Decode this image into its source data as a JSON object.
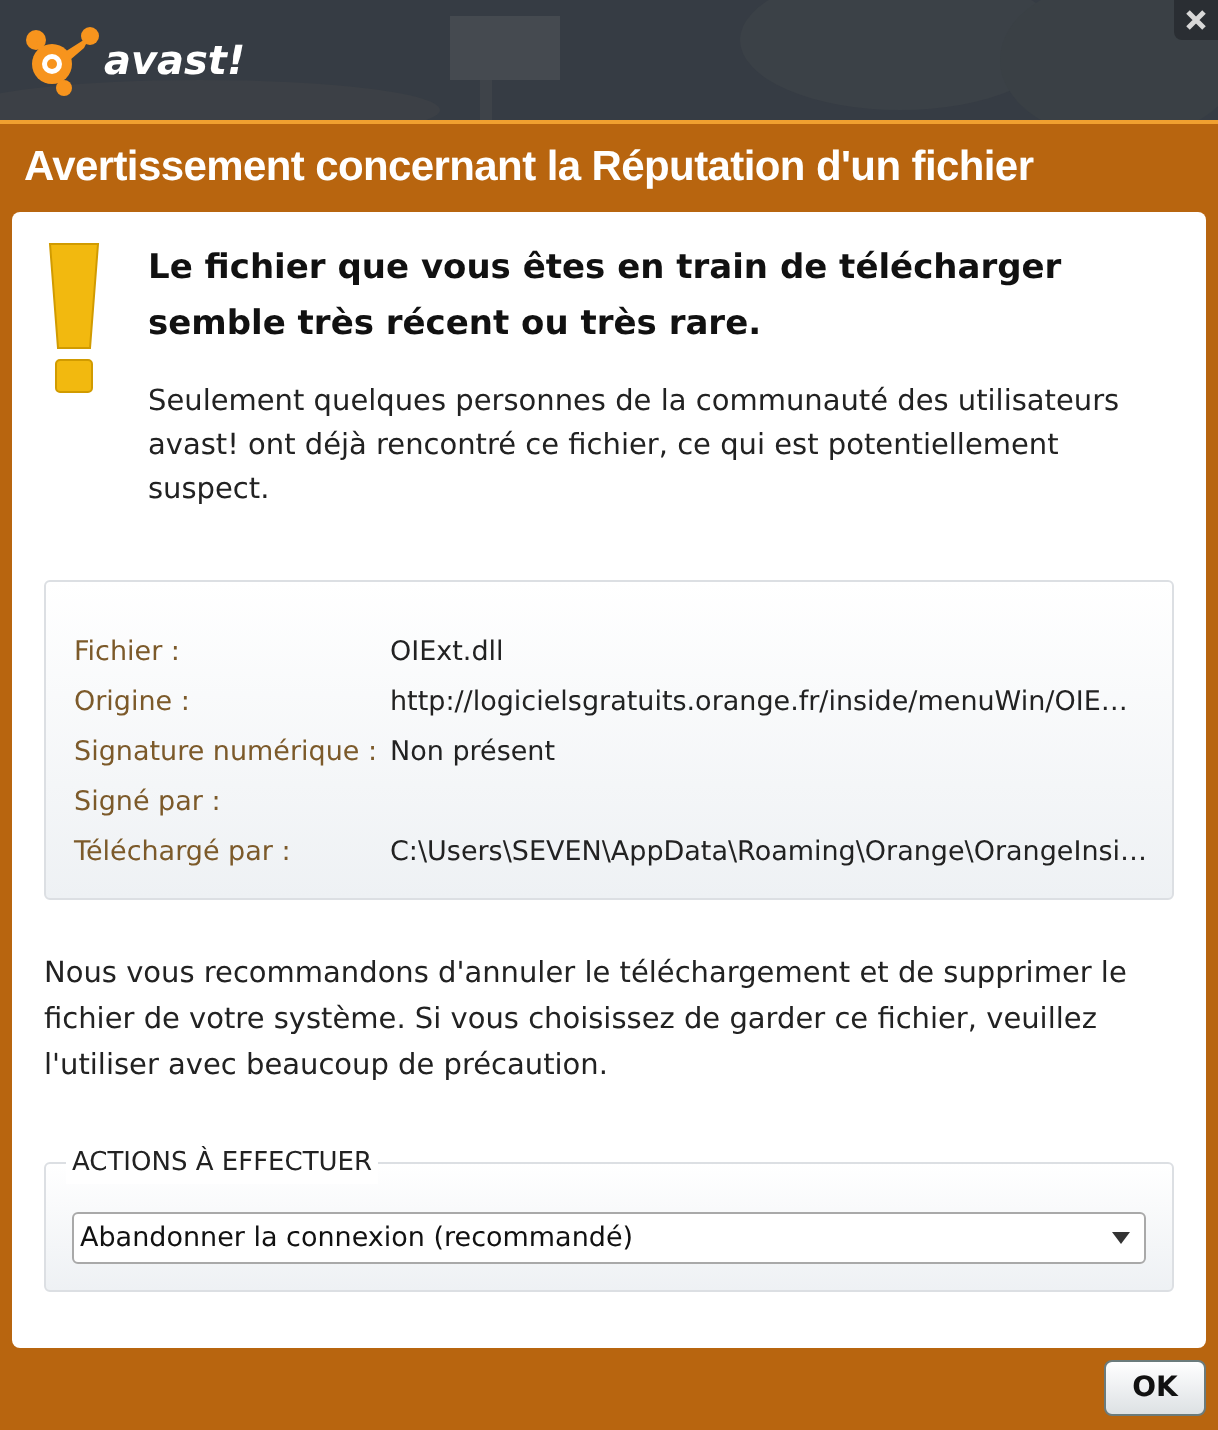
{
  "logo": {
    "text": "avast!"
  },
  "title": "Avertissement concernant la Réputation d'un fichier",
  "headline": "Le fichier que vous êtes en train de télécharger semble très récent ou très rare.",
  "description": "Seulement quelques personnes de la communauté des utilisateurs avast! ont déjà rencontré ce fichier, ce qui est potentiellement suspect.",
  "details": [
    {
      "label": "Fichier :",
      "value": "OIExt.dll"
    },
    {
      "label": "Origine :",
      "value": "http://logicielsgratuits.orange.fr/inside/menuWin/OIE…"
    },
    {
      "label": "Signature numérique :",
      "value": "Non présent"
    },
    {
      "label": "Signé par :"
    },
    {
      "label": "Téléchargé par :",
      "value": "C:\\Users\\SEVEN\\AppData\\Roaming\\Orange\\OrangeInsi…"
    }
  ],
  "recommendation": "Nous vous recommandons d'annuler le téléchargement et de supprimer le fichier de votre système. Si vous choisissez de garder ce fichier, veuillez l'utiliser avec beaucoup de précaution.",
  "actions": {
    "legend": "ACTIONS À EFFECTUER",
    "value": "Abandonner la connexion (recommandé)"
  },
  "ok_button": "OK"
}
